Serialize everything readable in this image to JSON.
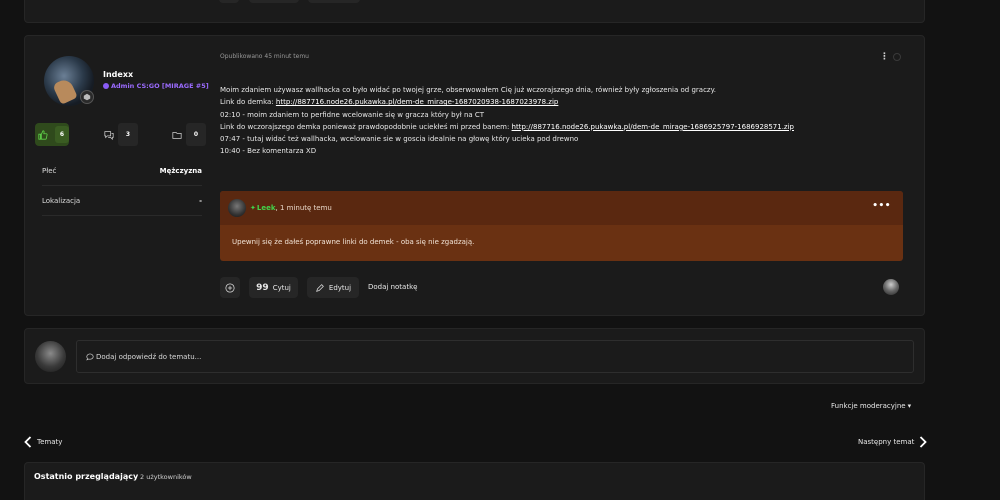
{
  "post": {
    "author": {
      "username": "Indexx",
      "role": "Admin CS:GO [MIRAGE #5]",
      "stats": {
        "likes": "6",
        "comments": "3",
        "posts": "0"
      },
      "fields": [
        {
          "label": "Płeć",
          "value": "Mężczyzna"
        },
        {
          "label": "Lokalizacja",
          "value": "-"
        }
      ]
    },
    "meta": "Opublikowano 45 minut temu",
    "content": {
      "line1": "Moim zdaniem używasz wallhacka co było widać po twojej grze, obserwowałem Cię już wczorajszego dnia, również były zgłoszenia od graczy.",
      "line2_prefix": "Link do demka: ",
      "line2_link": "http://887716.node26.pukawka.pl/dem-de_mirage-1687020938-1687023978.zip",
      "line3": "02:10 - moim zdaniem to perfidne wcelowanie się w gracza który był na CT",
      "line4_prefix": "Link do wczorajszego demka ponieważ prawdopodobnie uciekłeś mi przed banem: ",
      "line4_link": "http://887716.node26.pukawka.pl/dem-de_mirage-1686925797-1686928571.zip",
      "line5": "07:47 - tutaj widać też wallhacka, wcelowanie sie w goscia idealnie na głowę który ucieka pod drewno",
      "line6": "10:40 - Bez komentarza XD"
    },
    "comment": {
      "username": "Leek",
      "time": ", 1 minutę temu",
      "more": "•••",
      "text": "Upewnij się że dałeś poprawne linki do demek - oba się nie zgadzają."
    },
    "actions": {
      "quote_label": "Cytuj",
      "edit_label": "Edytuj",
      "note_label": "Dodaj notatkę"
    },
    "colors": {
      "like": "#2f4a1c",
      "quote_bg": "#6a3112",
      "leek_green": "#42d34a",
      "role_purple": "#9b6bff"
    }
  },
  "reply": {
    "placeholder": "Dodaj odpowiedź do tematu..."
  },
  "moderation": {
    "label": "Funkcje moderacyjne"
  },
  "navigation": {
    "prev": "Tematy",
    "next": "Następny temat"
  },
  "viewers": {
    "title": "Ostatnio przeglądający",
    "count": "2 użytkowników"
  }
}
